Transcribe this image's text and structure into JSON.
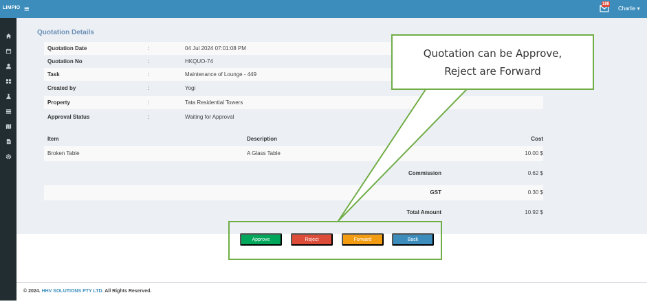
{
  "topbar": {
    "brand": "LIMPIO",
    "menu_icon": "hamburger-icon",
    "mail_badge": "188",
    "user": "Charlie",
    "user_caret": "▾"
  },
  "sidebar": {
    "icons": [
      "home-icon",
      "calendar-icon",
      "user-icon",
      "grid-icon",
      "flask-icon",
      "list-icon",
      "map-icon",
      "file-icon",
      "gear-icon"
    ]
  },
  "page": {
    "title": "Quotation Details"
  },
  "details": [
    {
      "label": "Quotation Date",
      "sep": ":",
      "value": "04 Jul 2024 07:01:08 PM"
    },
    {
      "label": "Quotation No",
      "sep": ":",
      "value": "HKQUO-74"
    },
    {
      "label": "Task",
      "sep": ":",
      "value": "Maintenance of Lounge - 449"
    },
    {
      "label": "Created by",
      "sep": ":",
      "value": "Yogi"
    },
    {
      "label": "Property",
      "sep": ":",
      "value": "Tata Residential Towers"
    },
    {
      "label": "Approval Status",
      "sep": ":",
      "value": "Waiting for Approval"
    }
  ],
  "items_table": {
    "headers": {
      "item": "Item",
      "description": "Description",
      "cost": "Cost"
    },
    "rows": [
      {
        "item": "Broken Table",
        "description": "A Glass Table",
        "cost": "10.00 $"
      }
    ],
    "summary": [
      {
        "label": "Commission",
        "value": "0.62 $"
      },
      {
        "label": "GST",
        "value": "0.30 $"
      },
      {
        "label": "Total Amount",
        "value": "10.92 $"
      }
    ]
  },
  "actions": {
    "approve": "Approve",
    "reject": "Reject",
    "forward": "Forward",
    "back": "Back"
  },
  "callout": {
    "line1": "Quotation can be Approve,",
    "line2": "Reject are Forward"
  },
  "footer": {
    "prefix": "© 2024.",
    "company": "HHV SOLUTIONS PTY LTD.",
    "suffix": "All Rights Reserved."
  },
  "colors": {
    "header": "#3c8dbc",
    "sidebar": "#222d32",
    "approve": "#00a65a",
    "reject": "#dd4b39",
    "forward": "#f39c12",
    "back": "#3c8dbc",
    "annotation": "#70ad47"
  }
}
